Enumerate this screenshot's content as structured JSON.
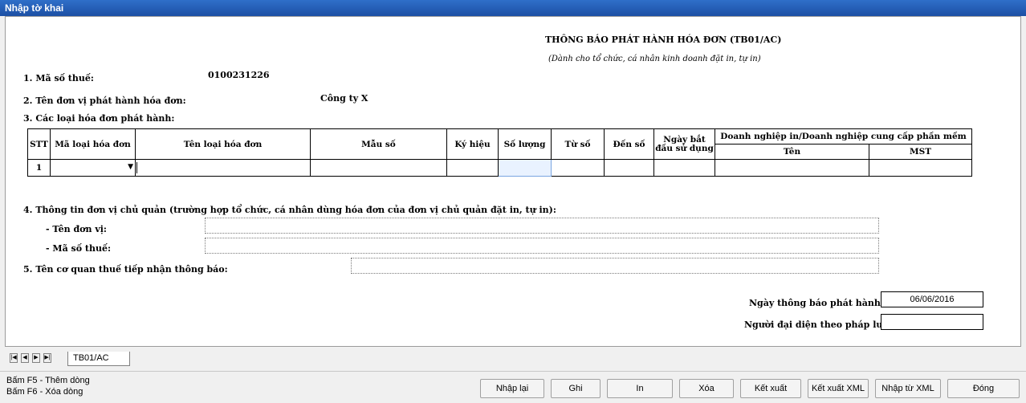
{
  "window": {
    "title": "Nhập tờ khai"
  },
  "form": {
    "title": "THÔNG BÁO PHÁT HÀNH HÓA ĐƠN (TB01/AC)",
    "subtitle": "(Dành cho tổ chức, cá nhân kinh doanh đặt in, tự in)",
    "tax_code_label": "1. Mã số thuế:",
    "tax_code_value": "0100231226",
    "issuer_label": "2. Tên đơn vị phát hành hóa đơn:",
    "issuer_value": "Công ty X",
    "invoice_types_label": "3. Các loại hóa đơn phát hành:",
    "parent_info_label": "4. Thông tin đơn vị chủ quản (trường hợp tổ chức, cá nhân dùng hóa đơn của đơn vị chủ quản đặt in, tự in):",
    "parent_name_label": "- Tên đơn vị:",
    "parent_name_value": "",
    "parent_tax_label": "- Mã số thuế:",
    "parent_tax_value": "",
    "tax_office_label": "5. Tên cơ quan thuế tiếp nhận thông báo:",
    "tax_office_value": "",
    "notice_date_label": "Ngày thông báo phát hành:",
    "notice_date_value": "06/06/2016",
    "legal_rep_label": "Người đại diện theo pháp luật:",
    "legal_rep_value": ""
  },
  "table": {
    "headers": {
      "stt": "STT",
      "code": "Mã loại hóa đơn",
      "name": "Tên loại hóa đơn",
      "form": "Mẫu số",
      "symbol": "Ký hiệu",
      "quantity": "Số lượng",
      "from": "Từ số",
      "to": "Đến số",
      "start_date": "Ngày bắt đầu sử dụng",
      "provider": "Doanh nghiệp in/Doanh nghiệp cung cấp phần mềm",
      "provider_name": "Tên",
      "provider_tax": "MST"
    },
    "rows": [
      {
        "stt": "1",
        "code": "",
        "name": "",
        "form": "",
        "symbol": "",
        "quantity": "",
        "from": "",
        "to": "",
        "start_date": "",
        "provider_name": "",
        "provider_tax": ""
      }
    ]
  },
  "tabs": {
    "active": "TB01/AC"
  },
  "status": {
    "hint_add": "Bấm F5 - Thêm dòng",
    "hint_delete": "Bấm F6 - Xóa dòng"
  },
  "buttons": {
    "reset": "Nhập lại",
    "save": "Ghi",
    "print": "In",
    "delete": "Xóa",
    "export": "Kết xuất",
    "export_xml": "Kết xuất XML",
    "import_xml": "Nhập từ XML",
    "close": "Đóng"
  }
}
